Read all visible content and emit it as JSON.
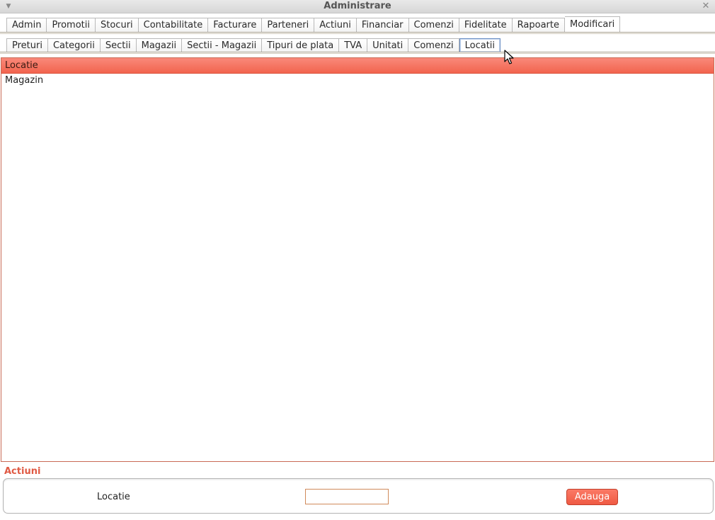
{
  "window": {
    "title": "Administrare",
    "menu_icon": "chevron-down-icon",
    "close_icon": "close-icon"
  },
  "main_tabs": [
    {
      "label": "Admin"
    },
    {
      "label": "Promotii"
    },
    {
      "label": "Stocuri"
    },
    {
      "label": "Contabilitate"
    },
    {
      "label": "Facturare"
    },
    {
      "label": "Parteneri"
    },
    {
      "label": "Actiuni"
    },
    {
      "label": "Financiar"
    },
    {
      "label": "Comenzi"
    },
    {
      "label": "Fidelitate"
    },
    {
      "label": "Rapoarte"
    },
    {
      "label": "Modificari"
    }
  ],
  "main_selected": "Modificari",
  "sub_tabs": [
    {
      "label": "Preturi"
    },
    {
      "label": "Categorii"
    },
    {
      "label": "Sectii"
    },
    {
      "label": "Magazii"
    },
    {
      "label": "Sectii - Magazii"
    },
    {
      "label": "Tipuri de plata"
    },
    {
      "label": "TVA"
    },
    {
      "label": "Unitati"
    },
    {
      "label": "Comenzi"
    },
    {
      "label": "Locatii"
    }
  ],
  "sub_selected": "Locatii",
  "table": {
    "header": "Locatie",
    "rows": [
      "Magazin"
    ]
  },
  "actions": {
    "section_label": "Actiuni",
    "field_label": "Locatie",
    "field_value": "",
    "field_placeholder": "",
    "add_label": "Adauga"
  },
  "colors": {
    "accent": "#f2644e",
    "header_text": "#3a1a12",
    "section_label": "#e05a44"
  }
}
